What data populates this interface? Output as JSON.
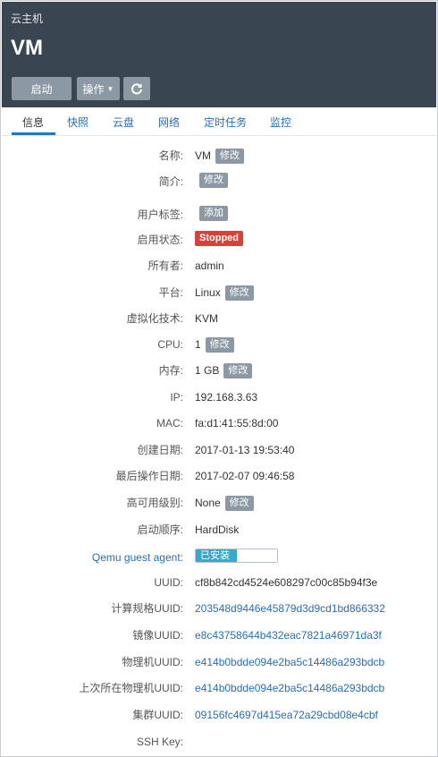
{
  "header": {
    "subtitle": "云主机",
    "title": "VM",
    "start_label": "启动",
    "ops_label": "操作",
    "caret_icon": "caret-down-icon",
    "refresh_icon": "refresh-icon"
  },
  "tabs": [
    {
      "label": "信息"
    },
    {
      "label": "快照"
    },
    {
      "label": "云盘"
    },
    {
      "label": "网络"
    },
    {
      "label": "定时任务"
    },
    {
      "label": "监控"
    }
  ],
  "edit_label": "修改",
  "add_label": "添加",
  "fields": {
    "name": {
      "label": "名称:",
      "value": "VM"
    },
    "desc": {
      "label": "简介:"
    },
    "tags": {
      "label": "用户标签:"
    },
    "state": {
      "label": "启用状态:",
      "value": "Stopped"
    },
    "owner": {
      "label": "所有者:",
      "value": "admin"
    },
    "platform": {
      "label": "平台:",
      "value": "Linux"
    },
    "virt": {
      "label": "虚拟化技术:",
      "value": "KVM"
    },
    "cpu": {
      "label": "CPU:",
      "value": "1"
    },
    "mem": {
      "label": "内存:",
      "value": "1 GB"
    },
    "ip": {
      "label": "IP:",
      "value": "192.168.3.63"
    },
    "mac": {
      "label": "MAC:",
      "value": "fa:d1:41:55:8d:00"
    },
    "created": {
      "label": "创建日期:",
      "value": "2017-01-13 19:53:40"
    },
    "lastop": {
      "label": "最后操作日期:",
      "value": "2017-02-07 09:46:58"
    },
    "ha": {
      "label": "高可用级别:",
      "value": "None"
    },
    "boot": {
      "label": "启动顺序:",
      "value": "HardDisk"
    },
    "agent": {
      "label": "Qemu guest agent:",
      "value": "已安装",
      "progress": 0.5
    },
    "uuid": {
      "label": "UUID:",
      "value": "cf8b842cd4524e608297c00c85b94f3e"
    },
    "spec": {
      "label": "计算规格UUID:",
      "value": "203548d9446e45879d3d9cd1bd866332"
    },
    "image": {
      "label": "镜像UUID:",
      "value": "e8c43758644b432eac7821a46971da3f"
    },
    "host": {
      "label": "物理机UUID:",
      "value": "e414b0bdde094e2ba5c14486a293bdcb"
    },
    "lasthost": {
      "label": "上次所在物理机UUID:",
      "value": "e414b0bdde094e2ba5c14486a293bdcb"
    },
    "cluster": {
      "label": "集群UUID:",
      "value": "09156fc4697d415ea72a29cbd08e4cbf"
    },
    "ssh": {
      "label": "SSH Key:"
    }
  },
  "colors": {
    "header_bg": "#3a4552",
    "button_bg": "#8c98a4",
    "link": "#2a6db0",
    "danger": "#d9403a",
    "progress": "#36a9cf"
  }
}
